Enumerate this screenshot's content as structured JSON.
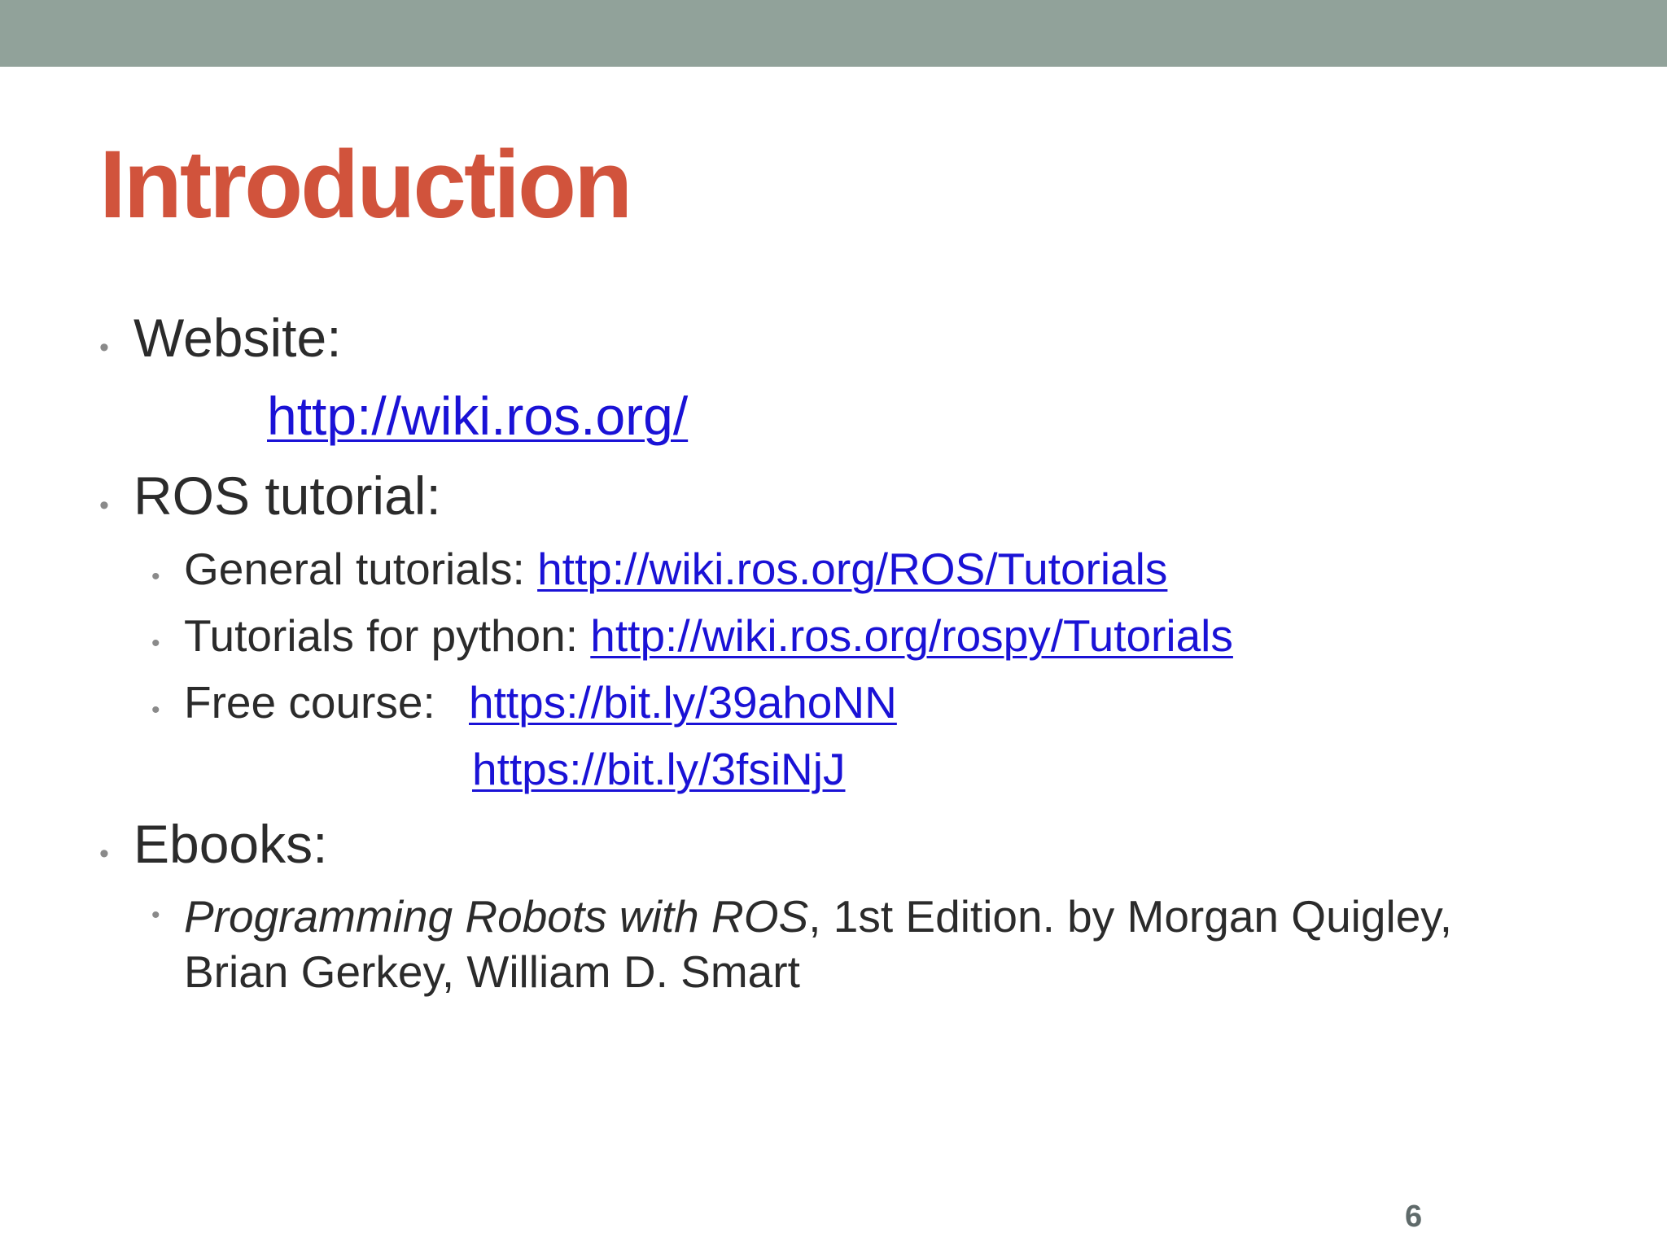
{
  "slide": {
    "title": "Introduction",
    "page_number": "6",
    "accent_color": "#d1533c",
    "top_bar_color": "#91a29a",
    "link_color": "#1a12d6"
  },
  "bullets": {
    "website": {
      "label": "Website:",
      "url": "http://wiki.ros.org/"
    },
    "ros_tutorial": {
      "label": "ROS tutorial:",
      "items": [
        {
          "label": "General tutorials: ",
          "url": "http://wiki.ros.org/ROS/Tutorials"
        },
        {
          "label": "Tutorials for python: ",
          "url": "http://wiki.ros.org/rospy/Tutorials"
        },
        {
          "label": "Free course:  ",
          "url": "https://bit.ly/39ahoNN",
          "url2": "https://bit.ly/3fsiNjJ"
        }
      ]
    },
    "ebooks": {
      "label": "Ebooks:",
      "items": [
        {
          "title": "Programming Robots with ROS",
          "rest_line1": ", 1st Edition. by Morgan Quigley,",
          "rest_line2": "Brian Gerkey, William D. Smart"
        }
      ]
    }
  },
  "icons": {
    "bullet": "bullet-dot"
  }
}
